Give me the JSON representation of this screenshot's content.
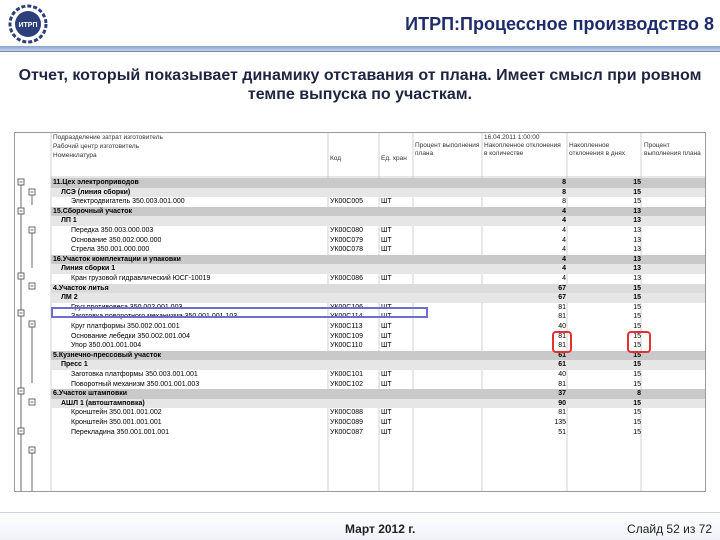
{
  "header": {
    "title": "ИТРП:Процессное производство 8",
    "logo_text": "ИТРП"
  },
  "description": "Отчет, который показывает динамику отставания от плана. Имеет смысл при ровном темпе выпуска по участкам.",
  "report": {
    "head": {
      "c1a": "Подразделение затрат изготовитель",
      "c1b": "Рабочий центр изготовитель",
      "c1c": "Номенклатура",
      "code": "Код",
      "unit": "Ед. хран",
      "date": "16.04.2011 1:00:00",
      "p1": "Процент выполнения плана",
      "p2": "Накопленное отклонения в количестве",
      "p3": "Накопленное отклонения в днях",
      "p4": "Процент выполнения плана"
    },
    "rows": [
      {
        "t": "grp",
        "name": "11.Цех электроприводов",
        "code": "",
        "unit": "",
        "a": "8",
        "b": "15"
      },
      {
        "t": "sub",
        "name": "ЛСЭ (линия сборки)",
        "code": "",
        "unit": "",
        "a": "8",
        "b": "15"
      },
      {
        "t": "item",
        "name": "Электродвигатель 350.003.001.000",
        "code": "УК00С005",
        "unit": "ШТ",
        "a": "8",
        "b": "15"
      },
      {
        "t": "grp",
        "name": "15.Сборочный участок",
        "code": "",
        "unit": "",
        "a": "4",
        "b": "13"
      },
      {
        "t": "sub",
        "name": "ЛП 1",
        "code": "",
        "unit": "",
        "a": "4",
        "b": "13"
      },
      {
        "t": "item",
        "name": "Передка 350.003.000.003",
        "code": "УК00С080",
        "unit": "ШТ",
        "a": "4",
        "b": "13"
      },
      {
        "t": "item",
        "name": "Основание 350.002.000.000",
        "code": "УК00С079",
        "unit": "ШТ",
        "a": "4",
        "b": "13"
      },
      {
        "t": "item",
        "name": "Стрела 350.001.000.000",
        "code": "УК00С078",
        "unit": "ШТ",
        "a": "4",
        "b": "13"
      },
      {
        "t": "grp",
        "name": "16.Участок комплектации и упаковки",
        "code": "",
        "unit": "",
        "a": "4",
        "b": "13"
      },
      {
        "t": "sub",
        "name": "Линия сборки 1",
        "code": "",
        "unit": "",
        "a": "4",
        "b": "13"
      },
      {
        "t": "item",
        "name": "Кран грузовой гидравлический ЮСГ-10019",
        "code": "УК00С086",
        "unit": "ШТ",
        "a": "4",
        "b": "13"
      },
      {
        "t": "sel",
        "name": "4.Участок литья",
        "code": "",
        "unit": "",
        "a": "67",
        "b": "15"
      },
      {
        "t": "sub",
        "name": "ЛМ 2",
        "code": "",
        "unit": "",
        "a": "67",
        "b": "15"
      },
      {
        "t": "item",
        "name": "Груз противовеса 350.002.001.003",
        "code": "УК00С106",
        "unit": "ШТ",
        "a": "81",
        "b": "15"
      },
      {
        "t": "item",
        "name": "Заготовка поворотного механизма 350.001.001.103",
        "code": "УК00С114",
        "unit": "ШТ",
        "a": "81",
        "b": "15"
      },
      {
        "t": "item",
        "name": "Круг платформы 350.002.001.001",
        "code": "УК00С113",
        "unit": "ШТ",
        "a": "40",
        "b": "15"
      },
      {
        "t": "item",
        "name": "Основание лебедки 350.002.001.004",
        "code": "УК00С109",
        "unit": "ШТ",
        "a": "81",
        "b": "15"
      },
      {
        "t": "item",
        "name": "Упор 350.001.001.004",
        "code": "УК00С110",
        "unit": "ШТ",
        "a": "81",
        "b": "15"
      },
      {
        "t": "grp",
        "name": "5.Кузнечно-прессовый участок",
        "code": "",
        "unit": "",
        "a": "61",
        "b": "15"
      },
      {
        "t": "sub",
        "name": "Пресс 1",
        "code": "",
        "unit": "",
        "a": "61",
        "b": "15"
      },
      {
        "t": "item",
        "name": "Заготовка платформы 350.003.001.001",
        "code": "УК00С101",
        "unit": "ШТ",
        "a": "40",
        "b": "15"
      },
      {
        "t": "item",
        "name": "Поворотный механизм 350.001.001.003",
        "code": "УК00С102",
        "unit": "ШТ",
        "a": "81",
        "b": "15"
      },
      {
        "t": "grp",
        "name": "6.Участок штамповки",
        "code": "",
        "unit": "",
        "a": "37",
        "b": "8"
      },
      {
        "t": "sub",
        "name": "АШЛ 1 (автоштамповка)",
        "code": "",
        "unit": "",
        "a": "90",
        "b": "15"
      },
      {
        "t": "item",
        "name": "Кронштейн 350.001.001.002",
        "code": "УК00С088",
        "unit": "ШТ",
        "a": "81",
        "b": "15"
      },
      {
        "t": "item",
        "name": "Кронштейн 350.001.001.001",
        "code": "УК00С089",
        "unit": "ШТ",
        "a": "135",
        "b": "15"
      },
      {
        "t": "item",
        "name": "Перекладина 350.001.001.001",
        "code": "УК00С087",
        "unit": "ШТ",
        "a": "51",
        "b": "15"
      }
    ]
  },
  "footer": {
    "date": "Март 2012 г.",
    "slide": "Слайд 52 из 72"
  },
  "colors": {
    "title": "#1e2c6b",
    "highlight": "#e53030",
    "selection": "#6a6fd0"
  }
}
